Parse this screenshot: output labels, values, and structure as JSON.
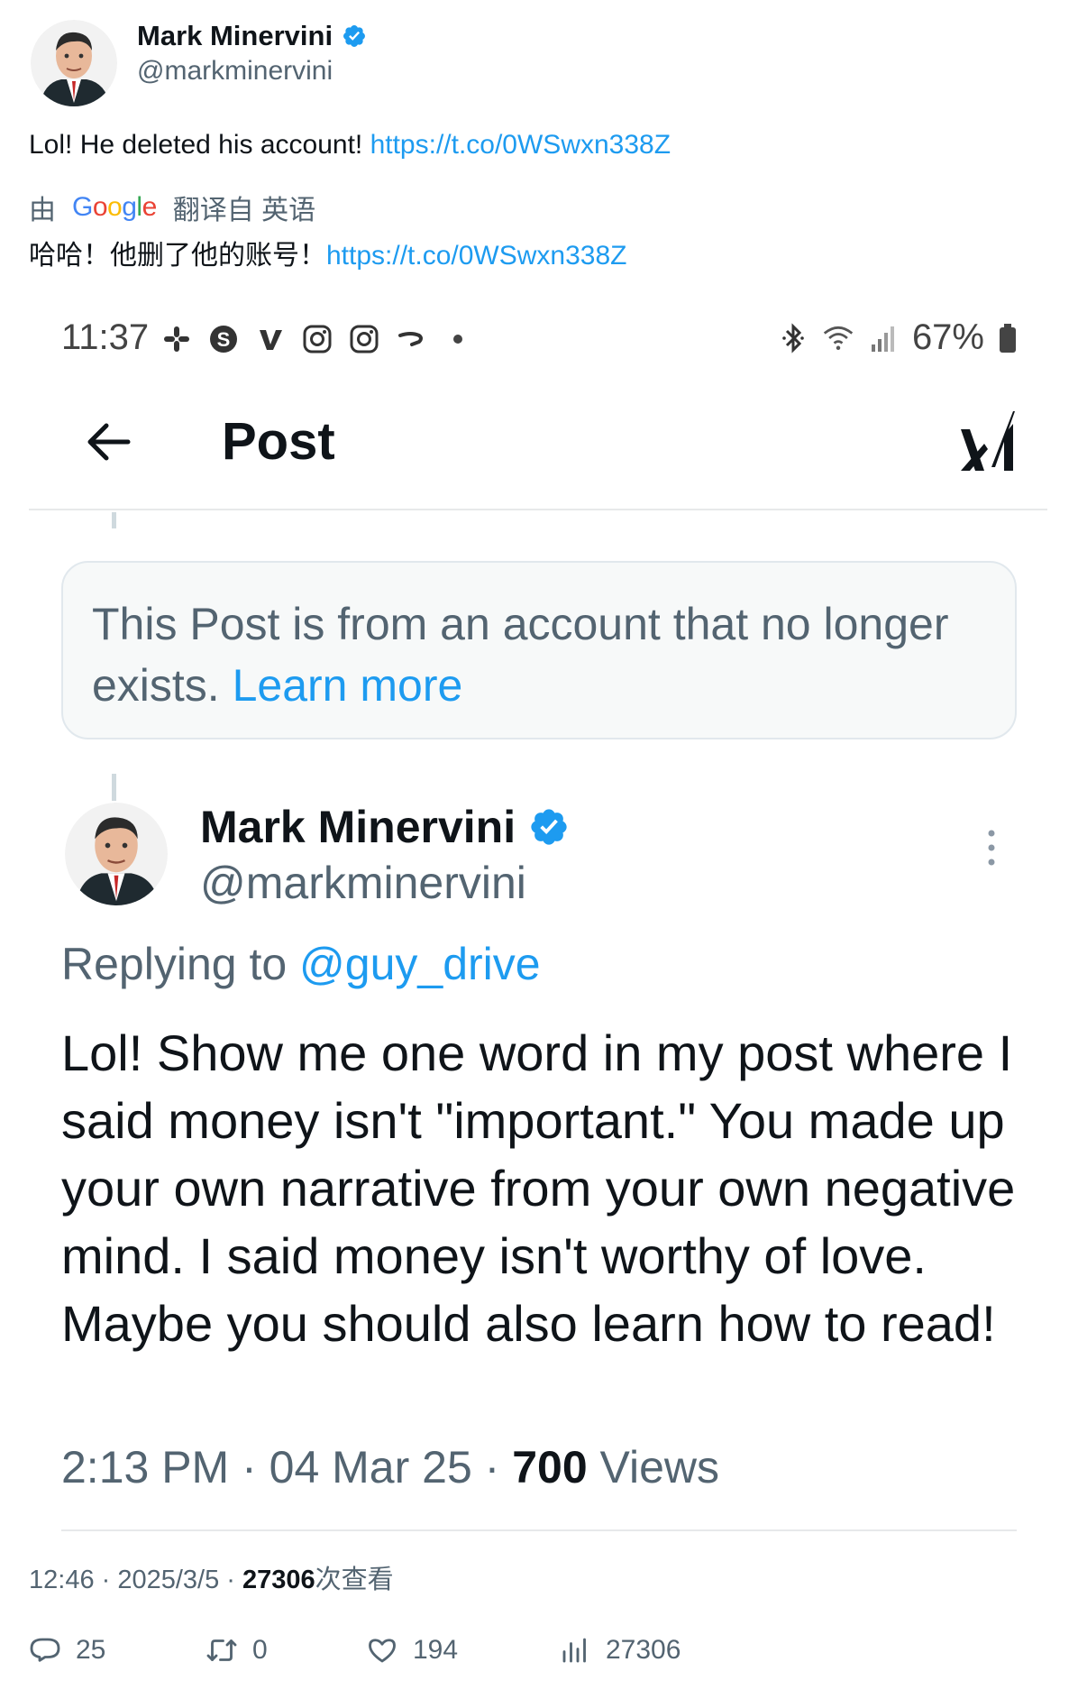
{
  "outer_tweet": {
    "author_name": "Mark Minervini",
    "author_handle": "@markminervini",
    "text": "Lol!  He deleted his account! ",
    "link": "https://t.co/0WSwxn338Z",
    "translation": {
      "by": "由",
      "google": [
        "G",
        "o",
        "o",
        "g",
        "l",
        "e"
      ],
      "from": "翻译自 英语",
      "text": "哈哈！他删了他的账号！",
      "link": "https://t.co/0WSwxn338Z"
    },
    "time": "12:46 · 2025/3/5 · ",
    "views_count": "27306",
    "views_label": "次查看",
    "actions": {
      "replies": "25",
      "reposts": "0",
      "likes": "194",
      "views": "27306"
    }
  },
  "screenshot": {
    "status_bar": {
      "time": "11:37",
      "left_icons": [
        "slack-icon",
        "skype-icon",
        "venmo-icon",
        "instagram-icon",
        "instagram-icon",
        "link-icon",
        "dot-icon"
      ],
      "right_icons": [
        "bluetooth-icon",
        "wifi-icon",
        "signal-icon"
      ],
      "battery": "67%"
    },
    "header": {
      "title": "Post"
    },
    "deleted_notice": {
      "text": "This Post is from an account that no longer exists. ",
      "link": "Learn more"
    },
    "post": {
      "author_name": "Mark Minervini",
      "author_handle": "@markminervini",
      "replying_prefix": "Replying to ",
      "replying_handle": "@guy_drive",
      "body": "Lol!  Show me one word in my post where I said money isn't \"important.\" You made up your own narrative from your own negative mind. I said money isn't worthy of love. Maybe you should also learn how to read!",
      "timestamp": "2:13 PM · 04 Mar 25 · ",
      "views_count": "700",
      "views_label": " Views"
    }
  },
  "colors": {
    "link": "#1d9bf0",
    "muted": "#536471",
    "verified": "#1d9bf0"
  }
}
